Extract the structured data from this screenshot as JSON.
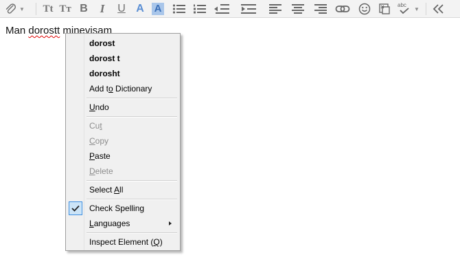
{
  "toolbar": {
    "buttons": [
      {
        "name": "attach-file-button",
        "icon": "paperclip-icon"
      },
      {
        "name": "font-size-smaller-button",
        "icon": "font-size-smaller-icon",
        "glyph": "Tt"
      },
      {
        "name": "font-size-larger-button",
        "icon": "font-size-larger-icon",
        "glyph": "Tт"
      },
      {
        "name": "bold-button",
        "icon": "bold-icon",
        "glyph": "B"
      },
      {
        "name": "italic-button",
        "icon": "italic-icon",
        "glyph": "I"
      },
      {
        "name": "underline-button",
        "icon": "underline-icon",
        "glyph": "U"
      },
      {
        "name": "text-color-button",
        "icon": "text-color-icon",
        "glyph": "A"
      },
      {
        "name": "highlight-color-button",
        "icon": "highlight-color-icon",
        "glyph": "A"
      },
      {
        "name": "bullet-list-button",
        "icon": "bullet-list-icon"
      },
      {
        "name": "numbered-list-button",
        "icon": "numbered-list-icon"
      },
      {
        "name": "outdent-button",
        "icon": "outdent-icon"
      },
      {
        "name": "indent-button",
        "icon": "indent-icon"
      },
      {
        "name": "align-left-button",
        "icon": "align-left-icon"
      },
      {
        "name": "align-center-button",
        "icon": "align-center-icon"
      },
      {
        "name": "align-right-button",
        "icon": "align-right-icon"
      },
      {
        "name": "insert-link-button",
        "icon": "link-icon"
      },
      {
        "name": "insert-emoji-button",
        "icon": "smiley-icon"
      },
      {
        "name": "insert-object-button",
        "icon": "insert-object-icon"
      },
      {
        "name": "spell-check-button",
        "icon": "spell-check-icon",
        "glyph": "abc"
      },
      {
        "name": "collapse-toolbar-button",
        "icon": "double-chevron-left-icon"
      }
    ],
    "accent_color": "#5b8fd4"
  },
  "editor": {
    "word1": "Man",
    "word2": "dorostt",
    "word3": "minevisam"
  },
  "context_menu": {
    "suggestions": [
      "dorost",
      "dorost t",
      "dorosht"
    ],
    "add_to_dictionary": {
      "before": "Add t",
      "accel": "o",
      "after": " Dictionary"
    },
    "undo": {
      "before": "",
      "accel": "U",
      "after": "ndo"
    },
    "cut": {
      "before": "Cu",
      "accel": "t",
      "after": ""
    },
    "copy": {
      "before": "",
      "accel": "C",
      "after": "opy"
    },
    "paste": {
      "before": "",
      "accel": "P",
      "after": "aste"
    },
    "delete": {
      "before": "",
      "accel": "D",
      "after": "elete"
    },
    "select_all": {
      "before": "Select ",
      "accel": "A",
      "after": "ll"
    },
    "check_spelling": {
      "before": "Check Spellin",
      "accel": "g",
      "after": "",
      "checked": true
    },
    "languages": {
      "before": "",
      "accel": "L",
      "after": "anguages"
    },
    "inspect_element": {
      "before": "Inspect Element (",
      "accel": "Q",
      "after": ")"
    },
    "disabled_color": "#8c8c8c",
    "check_highlight_color": "#cce4f7"
  }
}
